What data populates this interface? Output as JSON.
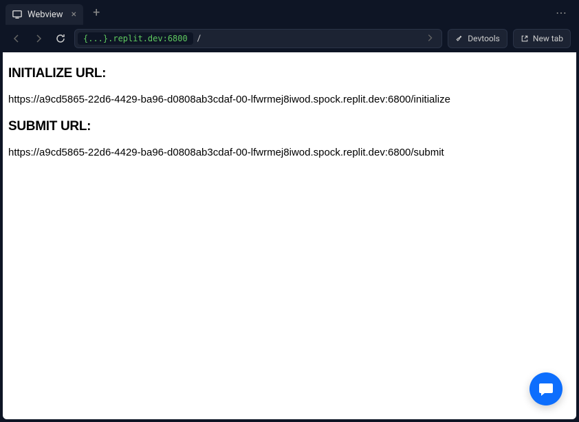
{
  "tab": {
    "title": "Webview"
  },
  "url_bar": {
    "host": "{...}.replit.dev:6800",
    "path": "/"
  },
  "toolbar": {
    "devtools_label": "Devtools",
    "newtab_label": "New tab"
  },
  "content": {
    "heading1": "INITIALIZE URL:",
    "url1": "https://a9cd5865-22d6-4429-ba96-d0808ab3cdaf-00-lfwrmej8iwod.spock.replit.dev:6800/initialize",
    "heading2": "SUBMIT URL:",
    "url2": "https://a9cd5865-22d6-4429-ba96-d0808ab3cdaf-00-lfwrmej8iwod.spock.replit.dev:6800/submit"
  }
}
